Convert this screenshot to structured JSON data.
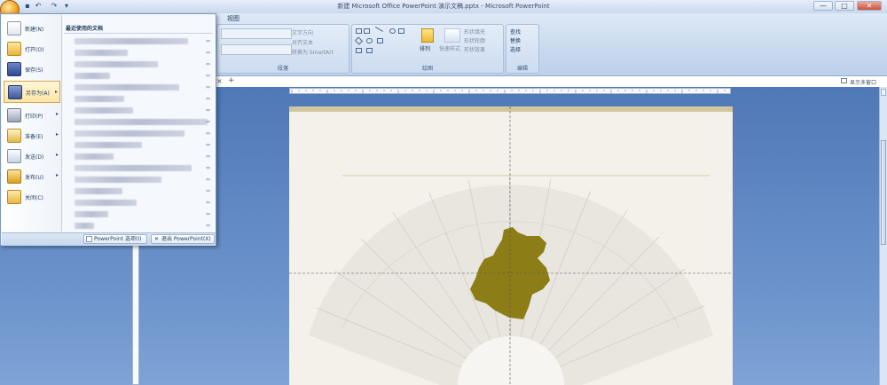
{
  "window": {
    "title": "新建 Microsoft Office PowerPoint 演示文稿.pptx - Microsoft PowerPoint",
    "minimize": "—",
    "maximize": "□",
    "close": "✕"
  },
  "qat": {
    "save": "▪",
    "undo": "↶",
    "redo": "↷",
    "more": "▾"
  },
  "ribbon": {
    "tab_view": "视图",
    "paragraph": {
      "label": "段落",
      "text_direction": "文字方向",
      "align_text": "对齐文本",
      "convert_smartart": "转换为 SmartArt"
    },
    "drawing": {
      "label": "绘图",
      "arrange": "排列",
      "quick_styles": "快速样式",
      "shape_fill": "形状填充",
      "shape_outline": "形状轮廓",
      "shape_effects": "形状效果"
    },
    "editing": {
      "label": "编辑",
      "find": "查找",
      "replace": "替换",
      "select": "选择"
    }
  },
  "tabbar": {
    "close_glyph": "×",
    "add_glyph": "+",
    "show_multi_window": "显示多窗口"
  },
  "office_menu": {
    "recent_title": "最近使用的文档",
    "items": [
      {
        "label": "新建(N)"
      },
      {
        "label": "打开(O)"
      },
      {
        "label": "保存(S)"
      },
      {
        "label": "另存为(A)"
      },
      {
        "label": "打印(P)"
      },
      {
        "label": "准备(E)"
      },
      {
        "label": "发送(D)"
      },
      {
        "label": "发布(U)"
      },
      {
        "label": "关闭(C)"
      }
    ],
    "pin_glyph": "⇔",
    "options_button": "PowerPoint 选项(I)",
    "exit_button": "退出 PowerPoint(X)"
  },
  "colors": {
    "ribbon_bg": "#c8d9ee",
    "workspace_bg": "#6d94cc",
    "slide_bg": "#f3f1ea",
    "slide_band": "#d1c79f",
    "map_shape": "#8c7d16",
    "menu_highlight": "#ffe6a3"
  }
}
